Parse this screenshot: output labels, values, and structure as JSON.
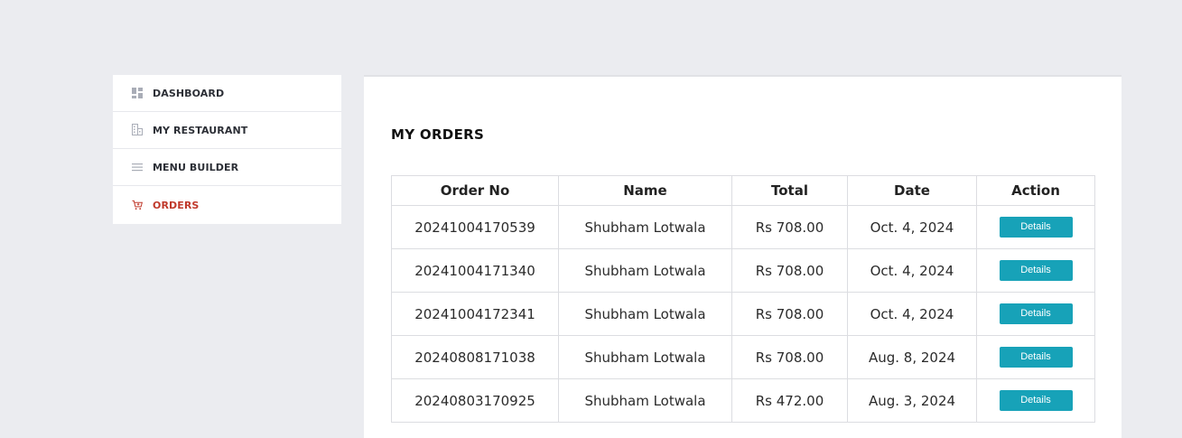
{
  "sidebar": {
    "items": [
      {
        "label": "DASHBOARD",
        "icon": "dashboard-icon",
        "active": false
      },
      {
        "label": "MY RESTAURANT",
        "icon": "restaurant-icon",
        "active": false
      },
      {
        "label": "MENU BUILDER",
        "icon": "menu-icon",
        "active": false
      },
      {
        "label": "ORDERS",
        "icon": "cart-icon",
        "active": true
      }
    ]
  },
  "main": {
    "title": "MY ORDERS",
    "table": {
      "headers": [
        "Order No",
        "Name",
        "Total",
        "Date",
        "Action"
      ],
      "rows": [
        {
          "order_no": "20241004170539",
          "name": "Shubham Lotwala",
          "total": "Rs 708.00",
          "date": "Oct. 4, 2024",
          "action": "Details"
        },
        {
          "order_no": "20241004171340",
          "name": "Shubham Lotwala",
          "total": "Rs 708.00",
          "date": "Oct. 4, 2024",
          "action": "Details"
        },
        {
          "order_no": "20241004172341",
          "name": "Shubham Lotwala",
          "total": "Rs 708.00",
          "date": "Oct. 4, 2024",
          "action": "Details"
        },
        {
          "order_no": "20240808171038",
          "name": "Shubham Lotwala",
          "total": "Rs 708.00",
          "date": "Aug. 8, 2024",
          "action": "Details"
        },
        {
          "order_no": "20240803170925",
          "name": "Shubham Lotwala",
          "total": "Rs 472.00",
          "date": "Aug. 3, 2024",
          "action": "Details"
        }
      ]
    }
  },
  "colors": {
    "background": "#ebecf0",
    "active_nav": "#c0392b",
    "button": "#17a2b8"
  }
}
